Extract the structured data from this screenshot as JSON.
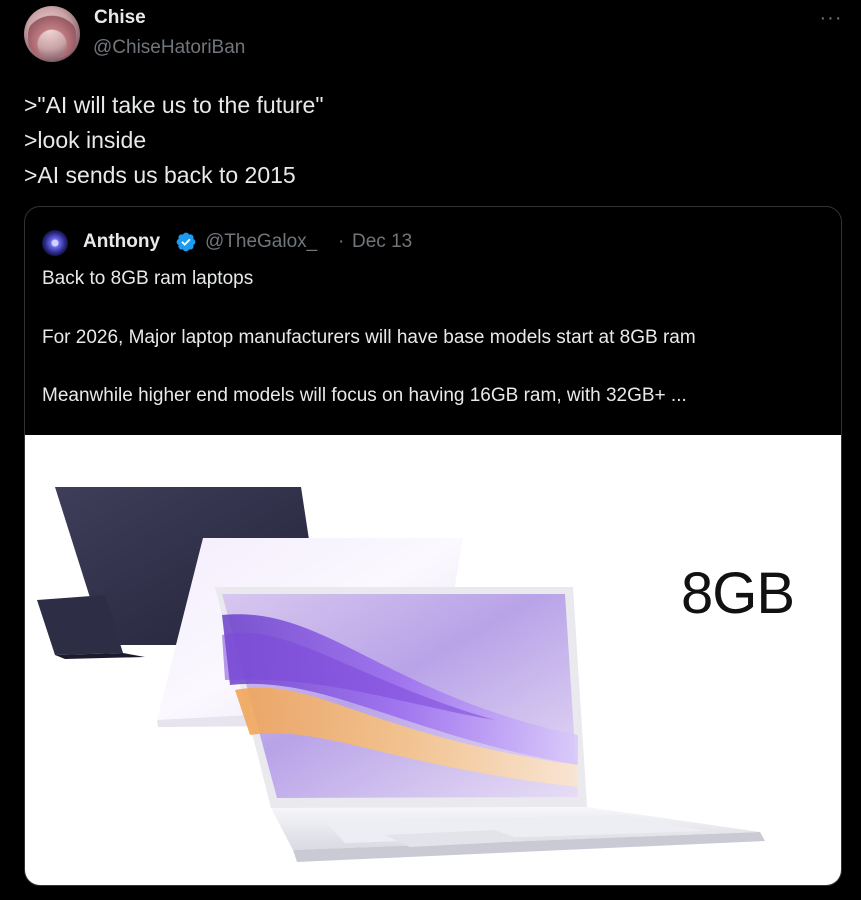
{
  "post": {
    "author_name": "Chise",
    "author_handle": "@ChiseHatoriBan",
    "more_label": "···",
    "text_lines": [
      ">\"AI will take us to the future\"",
      ">look inside",
      ">AI sends us back to 2015"
    ]
  },
  "quote": {
    "author_name": "Anthony",
    "author_handle": "@TheGalox_",
    "separator": "·",
    "date": "Dec 13",
    "lines": [
      "Back to 8GB ram laptops",
      "For 2026, Major laptop manufacturers will have base models start at 8GB ram",
      "Meanwhile higher end models will focus on having 16GB ram, with 32GB+ ..."
    ],
    "media": {
      "ram_label": "8GB"
    }
  },
  "colors": {
    "background": "#000000",
    "text_primary": "#e7e9ea",
    "text_secondary": "#71767b",
    "border": "#2f3336",
    "verified_badge": "#1d9bf0"
  }
}
